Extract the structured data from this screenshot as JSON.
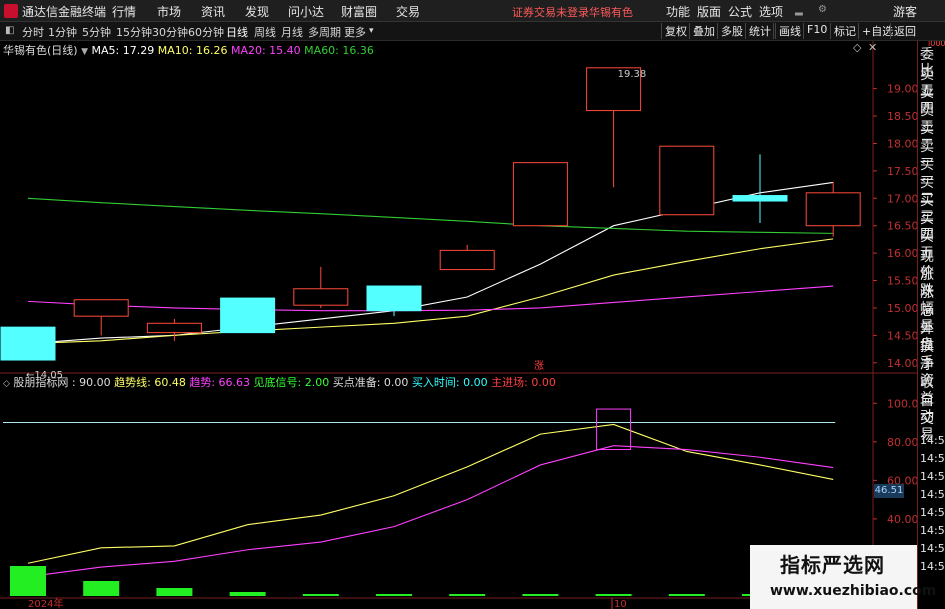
{
  "menubar": {
    "app_title": "通达信金融终端",
    "items": [
      "行情",
      "市场",
      "资讯",
      "发现",
      "问小达",
      "财富圈",
      "交易"
    ],
    "login_status": "证券交易未登录",
    "stock_name": "华锡有色",
    "right_items": [
      "功能",
      "版面",
      "公式",
      "选项",
      "游客"
    ]
  },
  "toolbar": {
    "periods": [
      "分时",
      "1分钟",
      "5分钟",
      "15分钟",
      "30分钟",
      "60分钟",
      "日线",
      "周线",
      "月线",
      "多周期",
      "更多"
    ],
    "active_period": "日线",
    "right_buttons": [
      "复权",
      "叠加",
      "多股",
      "统计",
      "画线",
      "F10",
      "标记",
      "+自选",
      "返回"
    ]
  },
  "main_chart": {
    "title": "华锡有色(日线)",
    "ma5_label": "MA5: 17.29",
    "ma10_label": "MA10: 16.26",
    "ma20_label": "MA20: 15.40",
    "ma60_label": "MA60: 16.36",
    "max_label": "19.38",
    "min_label": "←14.05",
    "rise_marker": "涨",
    "price_ticks": [
      "19.00",
      "18.50",
      "18.00",
      "17.50",
      "17.00",
      "16.50",
      "16.00",
      "15.50",
      "15.00",
      "14.50",
      "14.00"
    ]
  },
  "indicator_chart": {
    "name_label": "股朋指标网 : 90.00",
    "trend_line_label": "趋势线: 60.48",
    "trend_label": "趋势: 66.63",
    "bottom_signal_label": "见底信号: 2.00",
    "buy_prep_label": "买点准备: 0.00",
    "buy_time_label": "买入时间: 0.00",
    "main_force_label": "主进场: 0.00",
    "ticks": [
      "100.0",
      "80.00",
      "60.00",
      "40.00"
    ],
    "current_value": "46.51"
  },
  "x_axis": {
    "year_label": "2024年",
    "day_label": "10"
  },
  "right_panel": {
    "items": [
      "委比",
      "卖五",
      "卖四",
      "卖三",
      "卖二",
      "卖一",
      "买一",
      "买二",
      "买三",
      "买四",
      "买五",
      "现价",
      "涨跌",
      "涨幅",
      "总量",
      "外盘",
      "换手",
      "净资",
      "收益",
      "自动",
      "交易"
    ],
    "times": [
      "14:56",
      "14:56",
      "14:56",
      "14:56",
      "14:56",
      "14:56",
      "14:56",
      "14:56"
    ]
  },
  "watermark": {
    "line1": "指标严选网",
    "line2": "www.xuezhibiao.com"
  },
  "chart_data": {
    "type": "candlestick",
    "ylim": [
      13.85,
      19.65
    ],
    "candles": [
      {
        "open": 14.65,
        "close": 14.05,
        "high": 14.65,
        "low": 14.05
      },
      {
        "open": 14.85,
        "close": 15.15,
        "high": 15.15,
        "low": 14.5
      },
      {
        "open": 14.55,
        "close": 14.72,
        "high": 14.8,
        "low": 14.4
      },
      {
        "open": 15.18,
        "close": 14.55,
        "high": 15.18,
        "low": 14.55
      },
      {
        "open": 15.05,
        "close": 15.35,
        "high": 15.75,
        "low": 15.0
      },
      {
        "open": 15.4,
        "close": 14.95,
        "high": 15.4,
        "low": 14.85
      },
      {
        "open": 15.7,
        "close": 16.05,
        "high": 16.15,
        "low": 15.7
      },
      {
        "open": 16.5,
        "close": 17.65,
        "high": 17.65,
        "low": 16.5
      },
      {
        "open": 18.6,
        "close": 19.38,
        "high": 19.38,
        "low": 17.2
      },
      {
        "open": 16.7,
        "close": 17.95,
        "high": 17.95,
        "low": 16.7
      },
      {
        "open": 17.05,
        "close": 16.95,
        "high": 17.8,
        "low": 16.55
      },
      {
        "open": 16.5,
        "close": 17.1,
        "high": 17.3,
        "low": 16.3
      }
    ],
    "series": [
      {
        "name": "MA5",
        "color": "#ffffff",
        "values": [
          14.35,
          14.45,
          14.5,
          14.65,
          14.8,
          14.95,
          15.2,
          15.8,
          16.5,
          16.8,
          17.1,
          17.29
        ]
      },
      {
        "name": "MA10",
        "color": "#ffff66",
        "values": [
          14.35,
          14.4,
          14.5,
          14.58,
          14.65,
          14.72,
          14.85,
          15.2,
          15.6,
          15.85,
          16.08,
          16.26
        ]
      },
      {
        "name": "MA20",
        "color": "#ff40ff",
        "values": [
          15.12,
          15.05,
          15.0,
          14.97,
          14.95,
          14.95,
          14.96,
          15.0,
          15.1,
          15.2,
          15.3,
          15.4
        ]
      },
      {
        "name": "MA60",
        "color": "#33cc33",
        "values": [
          17.0,
          16.92,
          16.85,
          16.78,
          16.72,
          16.65,
          16.58,
          16.5,
          16.45,
          16.4,
          16.38,
          16.36
        ]
      }
    ],
    "indicator": {
      "ylim": [
        0,
        110
      ],
      "constant_line": 90,
      "trend_line": {
        "name": "趋势线",
        "color": "#ffff66",
        "values": [
          17,
          25,
          26,
          37,
          42,
          52,
          67,
          84,
          89,
          75,
          68,
          60.48
        ]
      },
      "trend": {
        "name": "趋势",
        "color": "#ff40ff",
        "values": [
          10,
          15,
          18,
          24,
          28,
          36,
          50,
          68,
          78,
          76,
          72,
          66.63
        ]
      },
      "box_signal_index": 8,
      "volume_bars": [
        30,
        15,
        8,
        4,
        2,
        2,
        2,
        2,
        2,
        2,
        2,
        2
      ]
    }
  }
}
